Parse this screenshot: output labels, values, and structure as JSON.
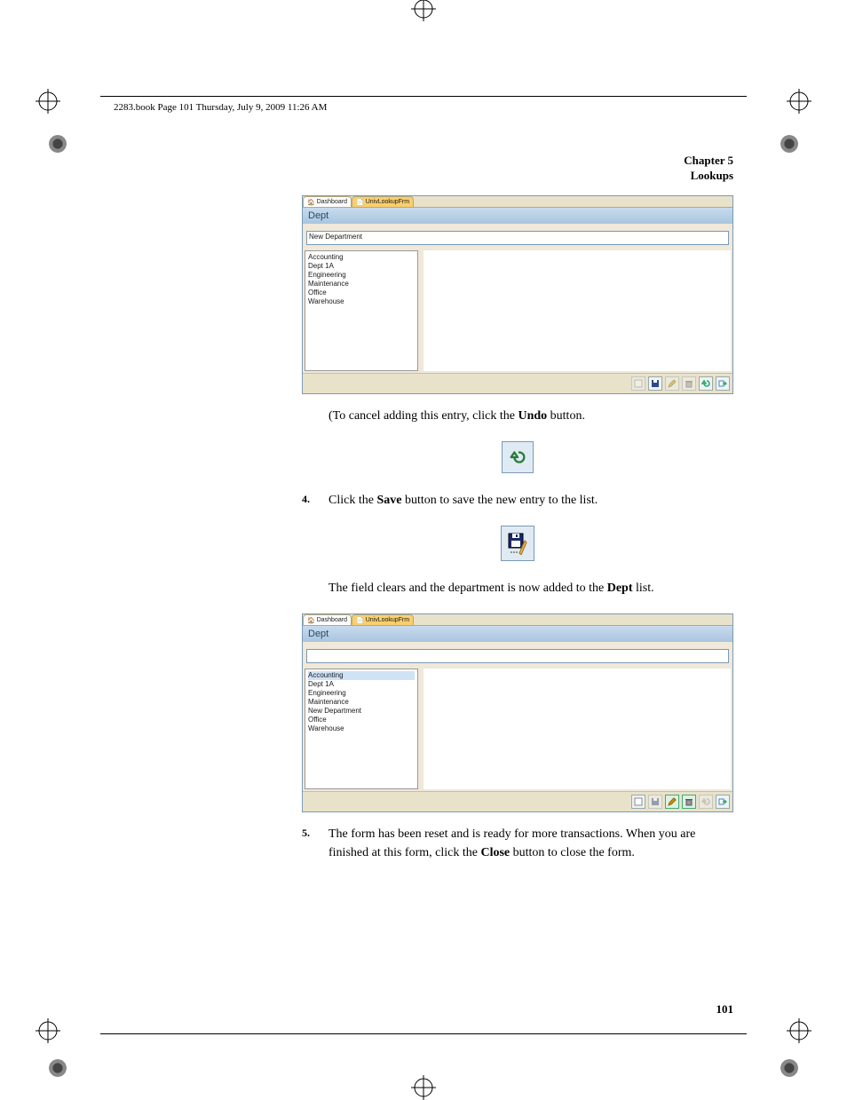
{
  "running_head": "2283.book  Page 101  Thursday, July 9, 2009  11:26 AM",
  "chapter": {
    "line1": "Chapter 5",
    "line2": "Lookups"
  },
  "page_number": "101",
  "shot1": {
    "tabs": {
      "dashboard": "Dashboard",
      "form": "UnivLookupFrm"
    },
    "title": "Dept",
    "field_value": "New Department",
    "list": [
      "Accounting",
      "Dept 1A",
      "Engineering",
      "Maintenance",
      "Office",
      "Warehouse"
    ],
    "toolbar_icons": [
      "new-icon",
      "save-icon",
      "edit-icon",
      "delete-icon",
      "undo-icon",
      "close-icon"
    ]
  },
  "para1": {
    "pre": "(To cancel adding this entry, click the ",
    "bold": "Undo",
    "post": " button."
  },
  "step4": {
    "num": "4.",
    "pre": "Click the ",
    "bold": "Save",
    "post": " button to save the new entry to the list."
  },
  "para2": {
    "pre": "The field clears and the department is now added to the ",
    "bold": "Dept",
    "post": " list."
  },
  "shot2": {
    "tabs": {
      "dashboard": "Dashboard",
      "form": "UnivLookupFrm"
    },
    "title": "Dept",
    "field_value": "",
    "list": [
      "Accounting",
      "Dept 1A",
      "Engineering",
      "Maintenance",
      "New Department",
      "Office",
      "Warehouse"
    ],
    "toolbar_icons": [
      "new-icon",
      "save-icon",
      "edit-icon",
      "delete-icon",
      "undo-icon",
      "close-icon"
    ]
  },
  "step5": {
    "num": "5.",
    "pre": "The form has been reset and is ready for more transactions. When you are finished at this form, click the ",
    "bold": "Close",
    "post": " button to close the form."
  }
}
